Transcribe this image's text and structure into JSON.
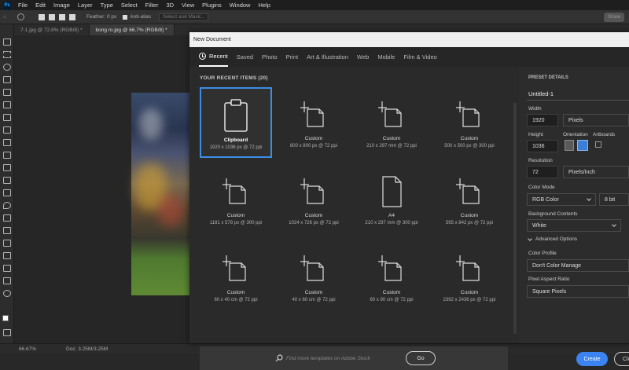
{
  "menubar": {
    "logo": "Ps",
    "items": [
      "File",
      "Edit",
      "Image",
      "Layer",
      "Type",
      "Select",
      "Filter",
      "3D",
      "View",
      "Plugins",
      "Window",
      "Help"
    ]
  },
  "options": {
    "feather_label": "Feather: 0 px",
    "antialias_label": "Anti-alias",
    "select_mask_label": "Select and Mask...",
    "share_label": "Share"
  },
  "doc_tabs": [
    {
      "label": "7-1.jpg @ 72.8% (RGB/8) *"
    },
    {
      "label": "bong ro.jpg @ 66.7% (RGB/8) *"
    }
  ],
  "status": {
    "zoom": "66.67%",
    "doc_size": "Doc: 3.25M/3.25M"
  },
  "dialog": {
    "title": "New Document",
    "tabs": [
      "Recent",
      "Saved",
      "Photo",
      "Print",
      "Art & Illustration",
      "Web",
      "Mobile",
      "Film & Video"
    ],
    "recent_heading": "YOUR RECENT ITEMS  (20)",
    "items": [
      {
        "name": "Clipboard",
        "dims": "1920 x 1036 px @ 72 ppi",
        "icon": "clipboard-icon"
      },
      {
        "name": "Custom",
        "dims": "800 x 800 px @ 72 ppi",
        "icon": "custom-doc-icon"
      },
      {
        "name": "Custom",
        "dims": "210 x 297 mm @ 72 ppi",
        "icon": "custom-doc-icon"
      },
      {
        "name": "Custom",
        "dims": "500 x 500 px @ 300 ppi",
        "icon": "custom-doc-icon"
      },
      {
        "name": "Custom",
        "dims": "1181 x 578 px @ 300 ppi",
        "icon": "custom-doc-icon"
      },
      {
        "name": "Custom",
        "dims": "1024 x 726 px @ 72 ppi",
        "icon": "custom-doc-icon"
      },
      {
        "name": "A4",
        "dims": "210 x 297 mm @ 300 ppi",
        "icon": "a4-doc-icon"
      },
      {
        "name": "Custom",
        "dims": "595 x 842 px @ 72 ppi",
        "icon": "custom-doc-icon"
      },
      {
        "name": "Custom",
        "dims": "60 x 40 cm @ 72 ppi",
        "icon": "custom-doc-icon"
      },
      {
        "name": "Custom",
        "dims": "40 x 60 cm @ 72 ppi",
        "icon": "custom-doc-icon"
      },
      {
        "name": "Custom",
        "dims": "60 x 90 cm @ 72 ppi",
        "icon": "custom-doc-icon"
      },
      {
        "name": "Custom",
        "dims": "2392 x 2436 px @ 72 ppi",
        "icon": "custom-doc-icon"
      }
    ],
    "search_placeholder": "Find more templates on Adobe Stock",
    "go_label": "Go",
    "preset": {
      "heading": "PRESET DETAILS",
      "name": "Untitled-1",
      "width_label": "Width",
      "width_value": "1920",
      "width_unit": "Pixels",
      "height_label": "Height",
      "height_value": "1036",
      "orientation_label": "Orientation",
      "artboards_label": "Artboards",
      "resolution_label": "Resolution",
      "resolution_value": "72",
      "resolution_unit": "Pixels/Inch",
      "color_mode_label": "Color Mode",
      "color_mode_value": "RGB Color",
      "bit_depth": "8 bit",
      "background_label": "Background Contents",
      "background_value": "White",
      "advanced_label": "Advanced Options",
      "color_profile_label": "Color Profile",
      "color_profile_value": "Don't Color Manage",
      "pixel_aspect_label": "Pixel Aspect Ratio",
      "pixel_aspect_value": "Square Pixels",
      "create_label": "Create",
      "close_label": "Clo"
    }
  }
}
